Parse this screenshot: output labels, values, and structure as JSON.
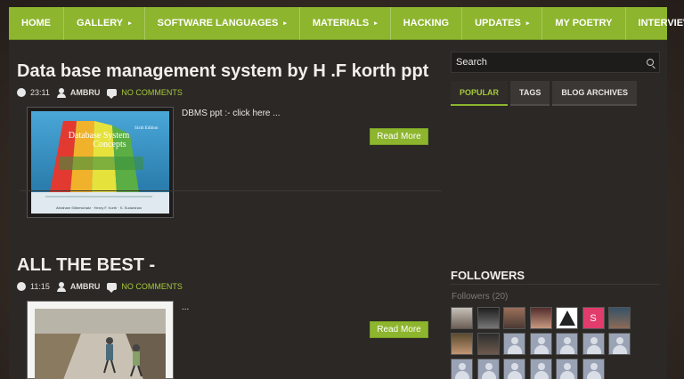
{
  "nav": {
    "items": [
      {
        "label": "HOME",
        "has_submenu": false
      },
      {
        "label": "GALLERY",
        "has_submenu": true
      },
      {
        "label": "SOFTWARE LANGUAGES",
        "has_submenu": true
      },
      {
        "label": "MATERIALS",
        "has_submenu": true
      },
      {
        "label": "HACKING",
        "has_submenu": false
      },
      {
        "label": "UPDATES",
        "has_submenu": true
      },
      {
        "label": "MY POETRY",
        "has_submenu": false
      },
      {
        "label": "INTERVIEWS",
        "has_submenu": false
      }
    ],
    "submenu_glyph": "▸"
  },
  "posts": [
    {
      "title": "Data base management system by H .F korth ppt",
      "time": "23:11",
      "author": "AMBRU",
      "comments": "NO COMMENTS",
      "excerpt": "DBMS ppt :- click here ...",
      "read_more": "Read More",
      "thumbnail": {
        "book_title_line1": "Database System",
        "book_title_line2": "Concepts",
        "edition": "Sixth Edition",
        "authors": "Abraham Silberschatz · Henry F. Korth · S. Sudarshan"
      }
    },
    {
      "title": "ALL THE BEST -",
      "time": "11:15",
      "author": "AMBRU",
      "comments": "NO COMMENTS",
      "excerpt": "...",
      "read_more": "Read More"
    }
  ],
  "sidebar": {
    "search_placeholder": "Search",
    "tabs": [
      {
        "label": "POPULAR",
        "active": true
      },
      {
        "label": "TAGS",
        "active": false
      },
      {
        "label": "BLOG ARCHIVES",
        "active": false
      }
    ],
    "followers_heading": "FOLLOWERS",
    "followers_count": "Followers (20)",
    "s_avatar_letter": "S"
  },
  "colors": {
    "accent": "#8db52e",
    "link": "#a6c93a",
    "panel": "#2b2826"
  }
}
